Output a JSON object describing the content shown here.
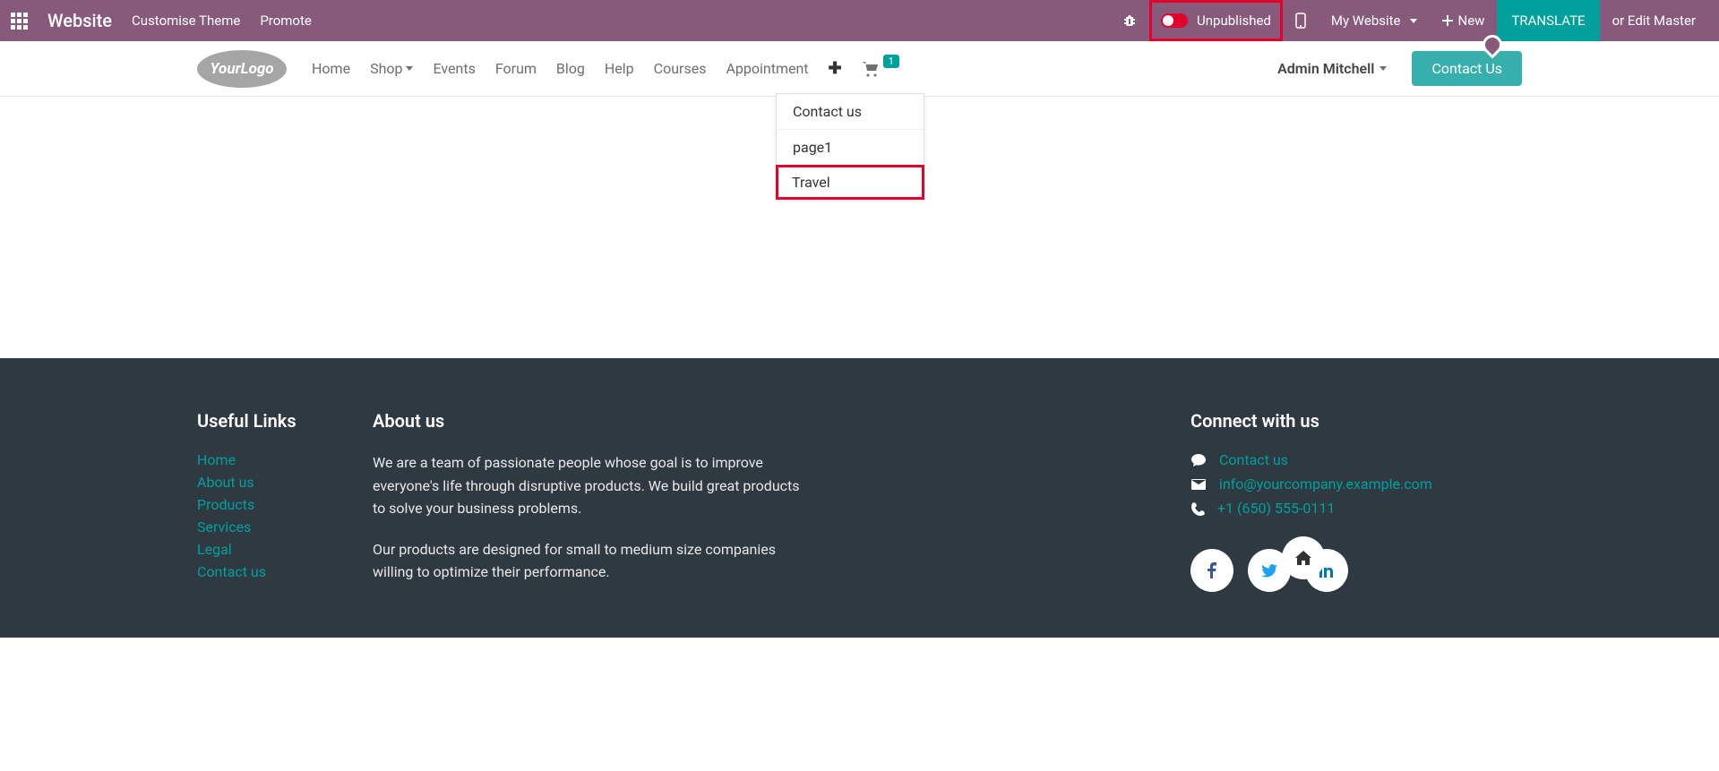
{
  "admin": {
    "title": "Website",
    "customise": "Customise Theme",
    "promote": "Promote",
    "unpublished": "Unpublished",
    "my_website": "My Website",
    "new": "New",
    "translate": "TRANSLATE",
    "edit_master": "or Edit Master"
  },
  "nav": {
    "home": "Home",
    "shop": "Shop",
    "events": "Events",
    "forum": "Forum",
    "blog": "Blog",
    "help": "Help",
    "courses": "Courses",
    "appointment": "Appointment",
    "cart_count": "1"
  },
  "user": {
    "name": "Admin Mitchell"
  },
  "cta": {
    "contact": "Contact Us"
  },
  "dropdown": {
    "item1": "Contact us",
    "item2": "page1",
    "item3": "Travel"
  },
  "footer": {
    "useful_title": "Useful Links",
    "links": {
      "home": "Home",
      "about": "About us",
      "products": "Products",
      "services": "Services",
      "legal": "Legal",
      "contact": "Contact us"
    },
    "about_title": "About us",
    "about_p1": "We are a team of passionate people whose goal is to improve everyone's life through disruptive products. We build great products to solve your business problems.",
    "about_p2": "Our products are designed for small to medium size companies willing to optimize their performance.",
    "connect_title": "Connect with us",
    "connect": {
      "contact": "Contact us",
      "email": "info@yourcompany.example.com",
      "phone": "+1 (650) 555-0111"
    }
  },
  "logo": {
    "text1": "Your",
    "text2": "Logo"
  }
}
